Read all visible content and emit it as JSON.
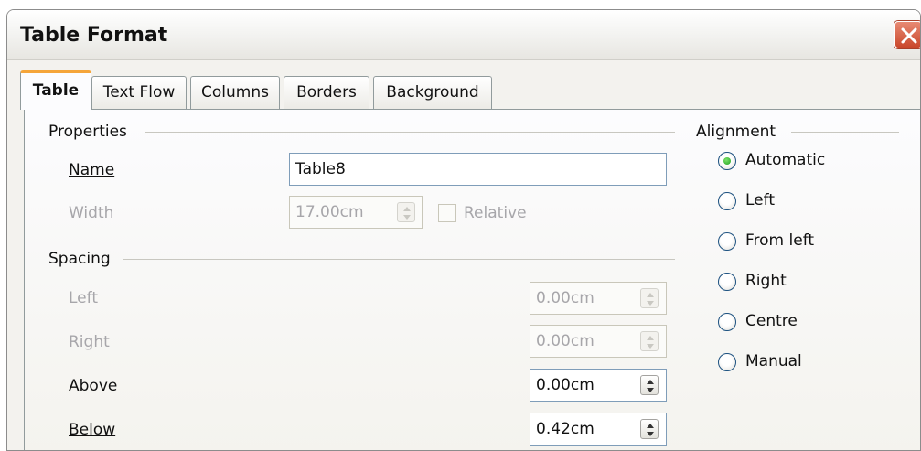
{
  "window": {
    "title": "Table Format"
  },
  "tabs": [
    {
      "label": "Table",
      "active": true
    },
    {
      "label": "Text Flow",
      "active": false
    },
    {
      "label": "Columns",
      "active": false
    },
    {
      "label": "Borders",
      "active": false
    },
    {
      "label": "Background",
      "active": false
    }
  ],
  "properties": {
    "section_label": "Properties",
    "name_label": "Name",
    "name_value": "Table8",
    "width_label": "Width",
    "width_value": "17.00cm",
    "relative_label": "Relative",
    "relative_checked": false
  },
  "spacing": {
    "section_label": "Spacing",
    "left_label": "Left",
    "left_value": "0.00cm",
    "right_label": "Right",
    "right_value": "0.00cm",
    "above_label": "Above",
    "above_value": "0.00cm",
    "below_label": "Below",
    "below_value": "0.42cm"
  },
  "alignment": {
    "section_label": "Alignment",
    "selected": "Automatic",
    "options": [
      "Automatic",
      "Left",
      "From left",
      "Right",
      "Centre",
      "Manual"
    ]
  },
  "colors": {
    "accent_tab": "#f5a53a",
    "close_button": "#c9472b",
    "radio_selected": "#21a121"
  },
  "icons": {
    "close": "close-icon",
    "spin": "spin-arrows-icon"
  }
}
